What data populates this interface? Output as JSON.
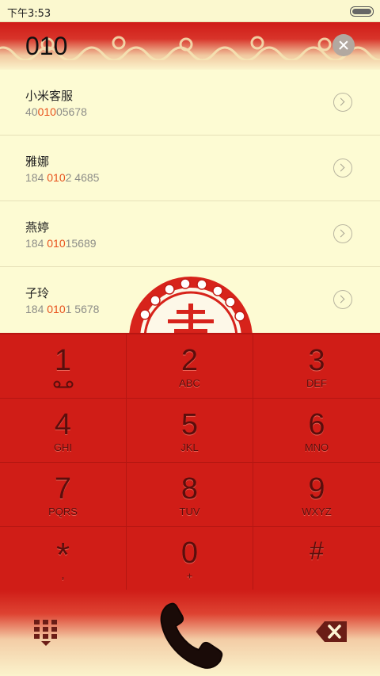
{
  "status_bar": {
    "time": "下午3:53"
  },
  "search": {
    "query": "010"
  },
  "results": [
    {
      "name": "小米客服",
      "number_pre": "40",
      "number_match": "010",
      "number_post": "05678"
    },
    {
      "name": "雅娜",
      "number_pre": "184 ",
      "number_match": "010",
      "number_post": "2 4685"
    },
    {
      "name": "燕婷",
      "number_pre": "184 ",
      "number_match": "010",
      "number_post": "15689"
    },
    {
      "name": "子玲",
      "number_pre": "184 ",
      "number_match": "010",
      "number_post": "1 5678"
    }
  ],
  "keypad": {
    "keys": [
      {
        "digit": "1",
        "letters": ""
      },
      {
        "digit": "2",
        "letters": "ABC"
      },
      {
        "digit": "3",
        "letters": "DEF"
      },
      {
        "digit": "4",
        "letters": "GHI"
      },
      {
        "digit": "5",
        "letters": "JKL"
      },
      {
        "digit": "6",
        "letters": "MNO"
      },
      {
        "digit": "7",
        "letters": "PQRS"
      },
      {
        "digit": "8",
        "letters": "TUV"
      },
      {
        "digit": "9",
        "letters": "WXYZ"
      },
      {
        "digit": "*",
        "letters": ","
      },
      {
        "digit": "0",
        "letters": "+"
      },
      {
        "digit": "#",
        "letters": ""
      }
    ]
  },
  "icons": {
    "voicemail": "voicemail-icon",
    "clear": "clear-icon",
    "dialpad": "dialpad-icon",
    "call": "phone-icon",
    "backspace": "backspace-icon",
    "battery": "battery-icon",
    "row_arrow": "chevron-right-icon"
  },
  "colors": {
    "keypad": "#d01d17",
    "key_text": "#5b0e0c",
    "highlight": "#e8511c",
    "list_bg": "#fdfbd3"
  }
}
